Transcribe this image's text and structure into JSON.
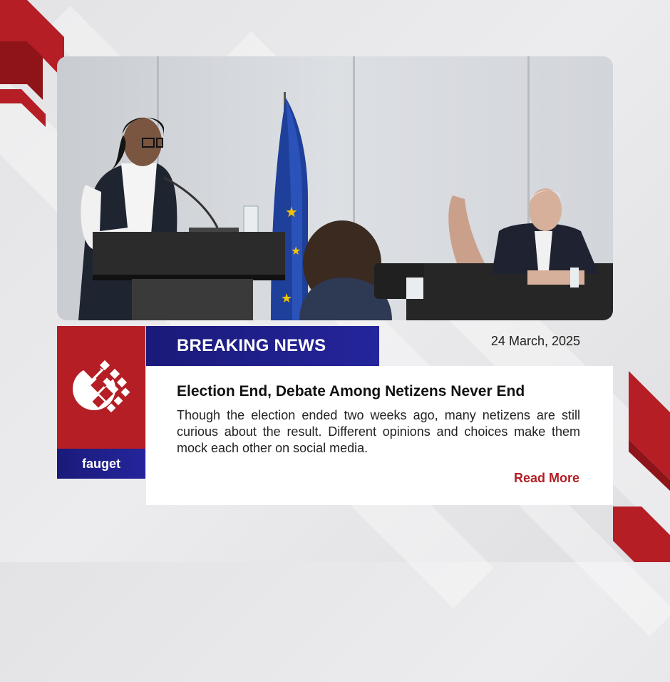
{
  "banner": {
    "label": "BREAKING NEWS",
    "date": "24 March, 2025"
  },
  "brand": {
    "name": "fauget",
    "logo_icon": "globe-tile-logo-icon"
  },
  "article": {
    "headline": "Election End, Debate Among Netizens Never End",
    "body": "Though the election ended two weeks ago, many netizens are still curious about the result. Different opinions and choices make them mock each other on social media.",
    "read_more": "Read More"
  },
  "colors": {
    "accent_red": "#b41e24",
    "navy": "#1f1f8c",
    "background": "#e6e6e8"
  }
}
